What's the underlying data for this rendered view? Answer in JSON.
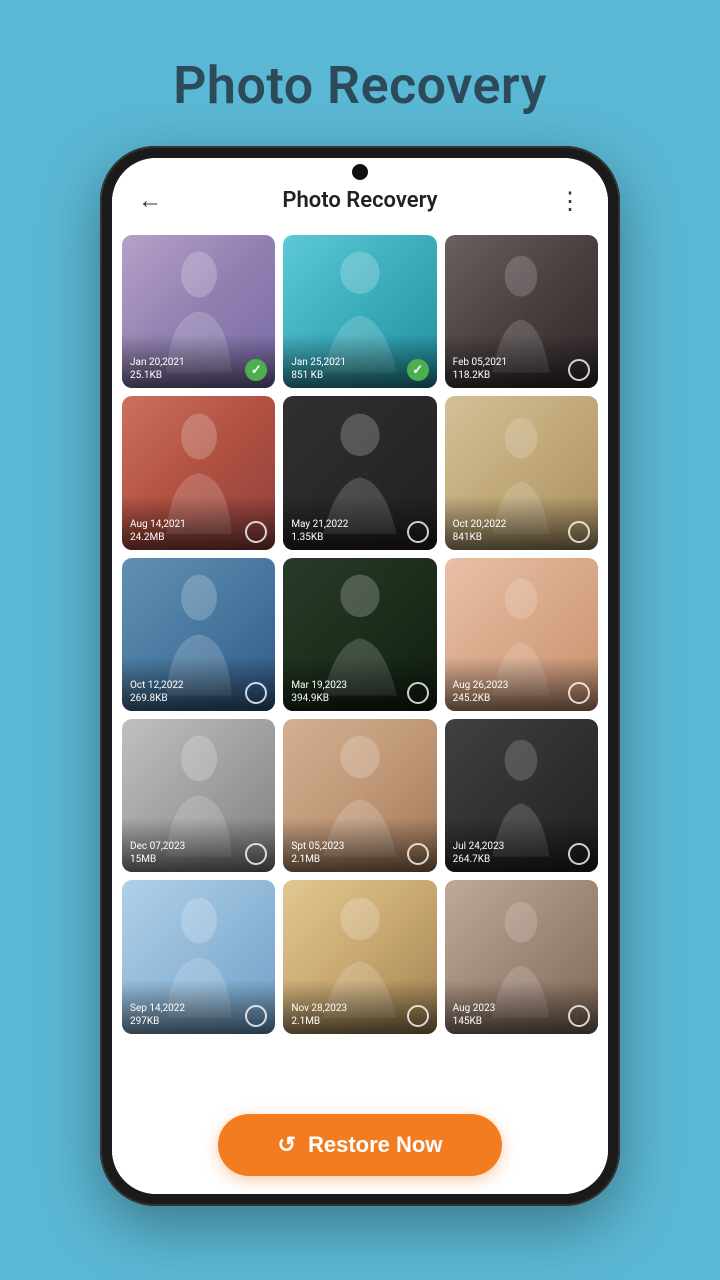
{
  "app": {
    "bg_title": "Photo Recovery",
    "screen_title": "Photo Recovery"
  },
  "header": {
    "back_label": "←",
    "title": "Photo Recovery",
    "menu_label": "⋮"
  },
  "photos": [
    {
      "id": 1,
      "date": "Jan 20,2021",
      "size": "25.1KB",
      "selected": true,
      "bg": "bg-1"
    },
    {
      "id": 2,
      "date": "Jan 25,2021",
      "size": "851 KB",
      "selected": true,
      "bg": "bg-2"
    },
    {
      "id": 3,
      "date": "Feb 05,2021",
      "size": "118.2KB",
      "selected": false,
      "bg": "bg-3"
    },
    {
      "id": 4,
      "date": "Aug 14,2021",
      "size": "24.2MB",
      "selected": false,
      "bg": "bg-4"
    },
    {
      "id": 5,
      "date": "May 21,2022",
      "size": "1.35KB",
      "selected": false,
      "bg": "bg-5"
    },
    {
      "id": 6,
      "date": "Oct 20,2022",
      "size": "841KB",
      "selected": false,
      "bg": "bg-6"
    },
    {
      "id": 7,
      "date": "Oct 12,2022",
      "size": "269.8KB",
      "selected": false,
      "bg": "bg-7"
    },
    {
      "id": 8,
      "date": "Mar 19,2023",
      "size": "394.9KB",
      "selected": false,
      "bg": "bg-8"
    },
    {
      "id": 9,
      "date": "Aug 26,2023",
      "size": "245.2KB",
      "selected": false,
      "bg": "bg-9"
    },
    {
      "id": 10,
      "date": "Dec 07,2023",
      "size": "15MB",
      "selected": false,
      "bg": "bg-10"
    },
    {
      "id": 11,
      "date": "Spt 05,2023",
      "size": "2.1MB",
      "selected": false,
      "bg": "bg-11"
    },
    {
      "id": 12,
      "date": "Jul 24,2023",
      "size": "264.7KB",
      "selected": false,
      "bg": "bg-12"
    },
    {
      "id": 13,
      "date": "Sep 14,2022",
      "size": "297KB",
      "selected": false,
      "bg": "bg-13"
    },
    {
      "id": 14,
      "date": "Nov 28,2023",
      "size": "2.1MB",
      "selected": false,
      "bg": "bg-14"
    },
    {
      "id": 15,
      "date": "Aug 2023",
      "size": "145KB",
      "selected": false,
      "bg": "bg-15"
    }
  ],
  "restore_button": {
    "label": "Restore Now",
    "icon": "↺"
  }
}
